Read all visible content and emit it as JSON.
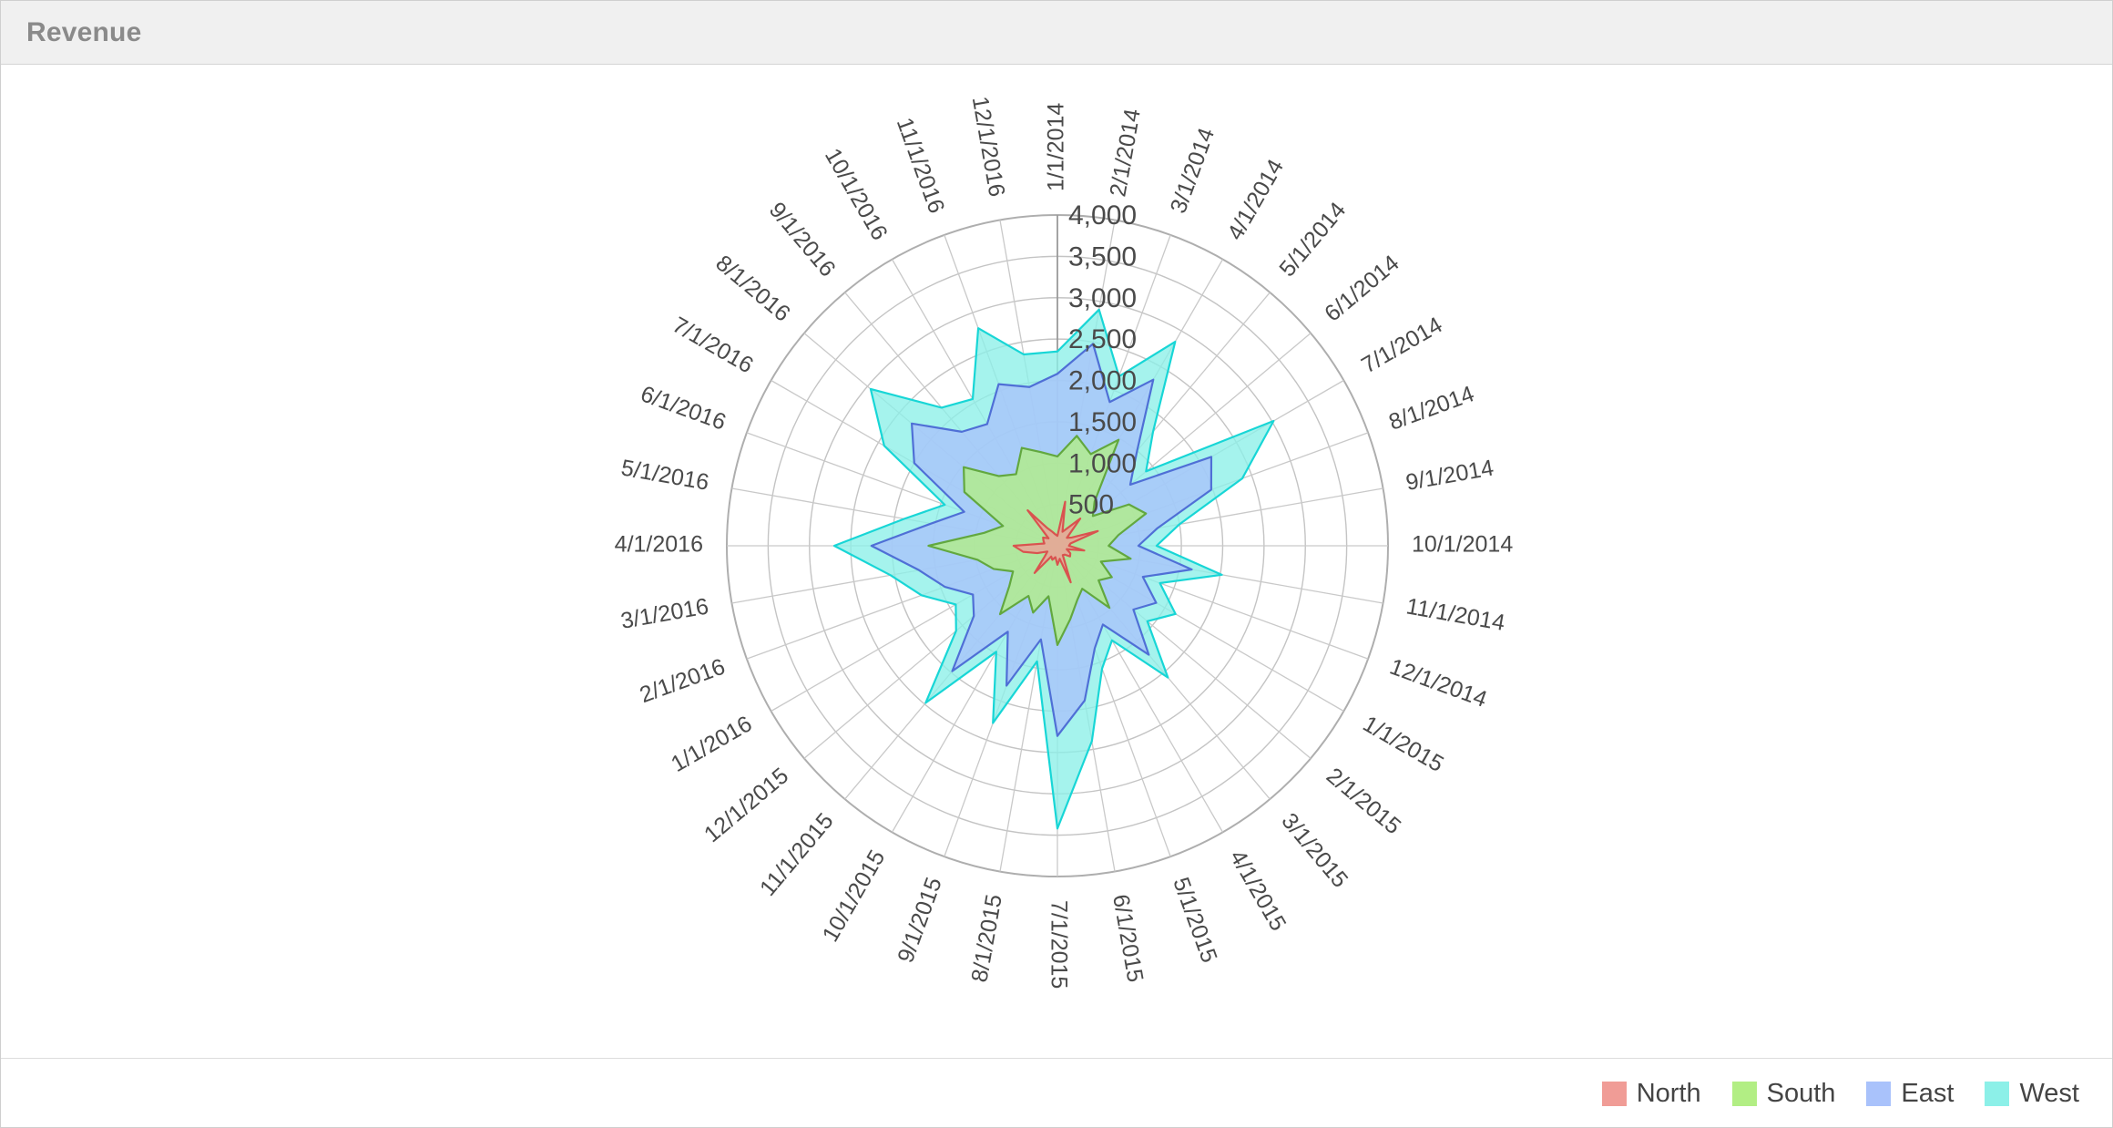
{
  "panel": {
    "title": "Revenue"
  },
  "legend": {
    "position": "bottom-right",
    "items": [
      {
        "label": "North",
        "color": "#f09c96"
      },
      {
        "label": "South",
        "color": "#b2ee84"
      },
      {
        "label": "East",
        "color": "#a9c2fb"
      },
      {
        "label": "West",
        "color": "#8cf0e8"
      }
    ]
  },
  "chart_data": {
    "type": "radar",
    "title": "Revenue",
    "xlabel": "",
    "ylabel": "",
    "grid": true,
    "start_angle_deg": 0,
    "direction": "clockwise",
    "radial_axis": {
      "min": 0,
      "max": 4000,
      "tick_interval": 500,
      "ticks": [
        500,
        1000,
        1500,
        2000,
        2500,
        3000,
        3500,
        4000
      ],
      "tick_labels": [
        "500",
        "1,000",
        "1,500",
        "2,000",
        "2,500",
        "3,000",
        "3,500",
        "4,000"
      ]
    },
    "categories": [
      "1/1/2014",
      "2/1/2014",
      "3/1/2014",
      "4/1/2014",
      "5/1/2014",
      "6/1/2014",
      "7/1/2014",
      "8/1/2014",
      "9/1/2014",
      "10/1/2014",
      "11/1/2014",
      "12/1/2014",
      "1/1/2015",
      "2/1/2015",
      "3/1/2015",
      "4/1/2015",
      "5/1/2015",
      "6/1/2015",
      "7/1/2015",
      "8/1/2015",
      "9/1/2015",
      "10/1/2015",
      "11/1/2015",
      "12/1/2015",
      "1/1/2016",
      "2/1/2016",
      "3/1/2016",
      "4/1/2016",
      "5/1/2016",
      "6/1/2016",
      "7/1/2016",
      "8/1/2016",
      "9/1/2016",
      "10/1/2016",
      "11/1/2016",
      "12/1/2016"
    ],
    "series": [
      {
        "name": "North",
        "color": "#f09c96",
        "stroke": "#d9534f",
        "values": [
          120,
          540,
          180,
          250,
          430,
          150,
          200,
          520,
          160,
          140,
          330,
          120,
          180,
          200,
          140,
          130,
          470,
          160,
          230,
          140,
          180,
          150,
          430,
          200,
          140,
          260,
          420,
          530,
          160,
          180,
          200,
          140,
          560,
          250,
          180,
          140
        ]
      },
      {
        "name": "South",
        "color": "#b2ee84",
        "stroke": "#62a83f",
        "values": [
          1080,
          1350,
          1180,
          1480,
          700,
          560,
          1000,
          1140,
          750,
          620,
          900,
          560,
          760,
          650,
          980,
          600,
          700,
          900,
          1200,
          620,
          860,
          700,
          1080,
          760,
          620,
          820,
          980,
          1560,
          900,
          700,
          1300,
          1480,
          1100,
          1000,
          1260,
          1150
        ]
      },
      {
        "name": "East",
        "color": "#a9c2fb",
        "stroke": "#4f6fd6",
        "values": [
          2080,
          2480,
          1850,
          2320,
          1500,
          1150,
          2150,
          1980,
          1230,
          980,
          1650,
          1100,
          1380,
          1200,
          1720,
          1100,
          1320,
          1900,
          2300,
          1150,
          1800,
          1200,
          1980,
          1320,
          1180,
          1450,
          1700,
          2250,
          1550,
          1200,
          2000,
          2300,
          1800,
          1700,
          2080,
          1950
        ]
      },
      {
        "name": "West",
        "color": "#8cf0e8",
        "stroke": "#18d6d6",
        "values": [
          2350,
          2900,
          2180,
          2850,
          1800,
          1400,
          3020,
          2380,
          1500,
          1200,
          2020,
          1320,
          1650,
          1420,
          2080,
          1320,
          1580,
          2400,
          3420,
          1420,
          2280,
          1480,
          2480,
          1600,
          1420,
          1750,
          2050,
          2700,
          1880,
          1450,
          2420,
          2950,
          2180,
          2050,
          2800,
          2350
        ]
      }
    ]
  }
}
